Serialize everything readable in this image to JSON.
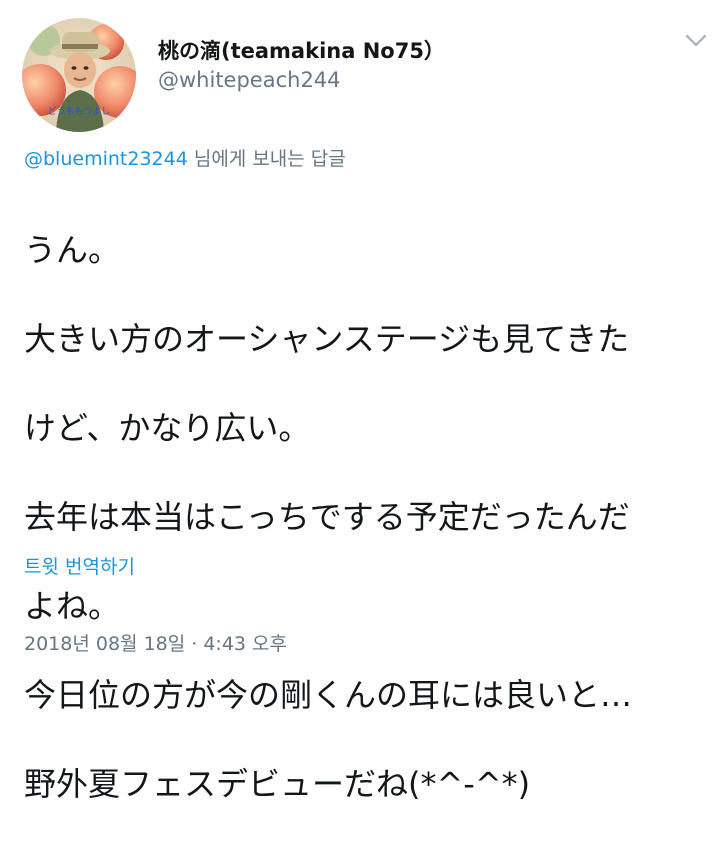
{
  "author": {
    "display_name": "桃の滴(teamakina No75）",
    "handle": "@whitepeach244",
    "avatar_caption": "どうももつよし"
  },
  "header": {
    "more_icon": "chevron-down-icon"
  },
  "reply_context": {
    "mention": "@bluemint23244",
    "suffix": " 님에게 보내는 답글"
  },
  "tweet": {
    "text_lines": [
      "うん。",
      "大きい方のオーシャンステージも見てきた",
      "けど、かなり広い。",
      "去年は本当はこっちでする予定だったんだ",
      "よね。",
      "今日位の方が今の剛くんの耳には良いと…",
      "野外夏フェスデビューだね(*^-^*)"
    ]
  },
  "actions": {
    "translate_label": "트윗 번역하기"
  },
  "meta": {
    "timestamp": "2018년 08월 18일 · 4:43 오후"
  },
  "colors": {
    "link": "#1b95e0",
    "secondary_text": "#657786",
    "primary_text": "#14171a"
  }
}
